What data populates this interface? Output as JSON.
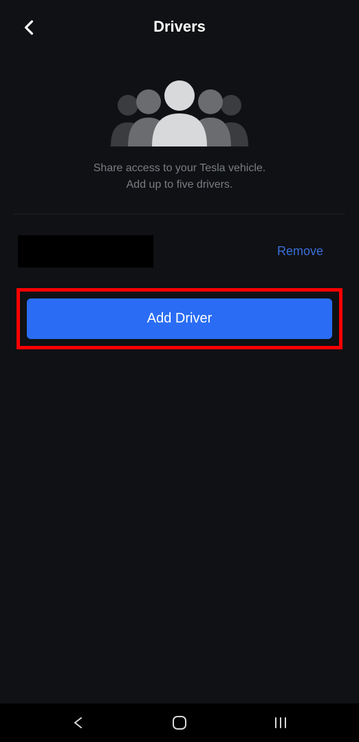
{
  "header": {
    "title": "Drivers"
  },
  "description": {
    "line1": "Share access to your Tesla vehicle.",
    "line2": "Add up to five drivers."
  },
  "drivers": {
    "remove_label": "Remove"
  },
  "actions": {
    "add_driver_label": "Add Driver"
  },
  "colors": {
    "accent_blue": "#2a6df4",
    "link_blue": "#3b6fd8",
    "highlight_red": "#ff0000"
  }
}
